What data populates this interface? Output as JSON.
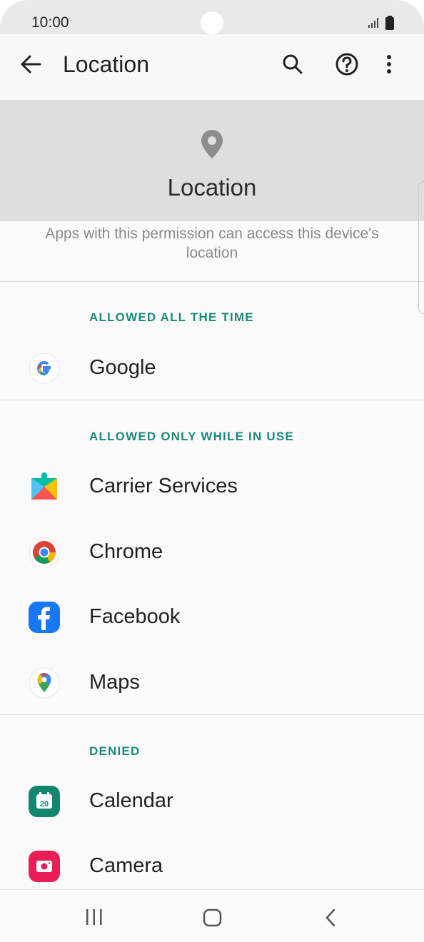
{
  "status_bar": {
    "time": "10:00"
  },
  "app_bar": {
    "title": "Location",
    "icons": [
      "arrow-back-icon",
      "search-icon",
      "help-icon",
      "more-vert-icon"
    ]
  },
  "header": {
    "icon": "location-pin-icon",
    "title": "Location",
    "description": "Apps with this permission can access this device's location"
  },
  "sections": [
    {
      "label": "ALLOWED ALL THE TIME",
      "apps": [
        "Google"
      ]
    },
    {
      "label": "ALLOWED ONLY WHILE IN USE",
      "apps": [
        "Carrier Services",
        "Chrome",
        "Facebook",
        "Maps"
      ]
    },
    {
      "label": "DENIED",
      "apps": [
        "Calendar",
        "Camera"
      ]
    }
  ],
  "colors": {
    "accent": "#1a8a7c",
    "header_bg": "#dedede"
  },
  "nav_bar": {
    "icons": [
      "recents-icon",
      "home-icon",
      "back-icon"
    ]
  }
}
